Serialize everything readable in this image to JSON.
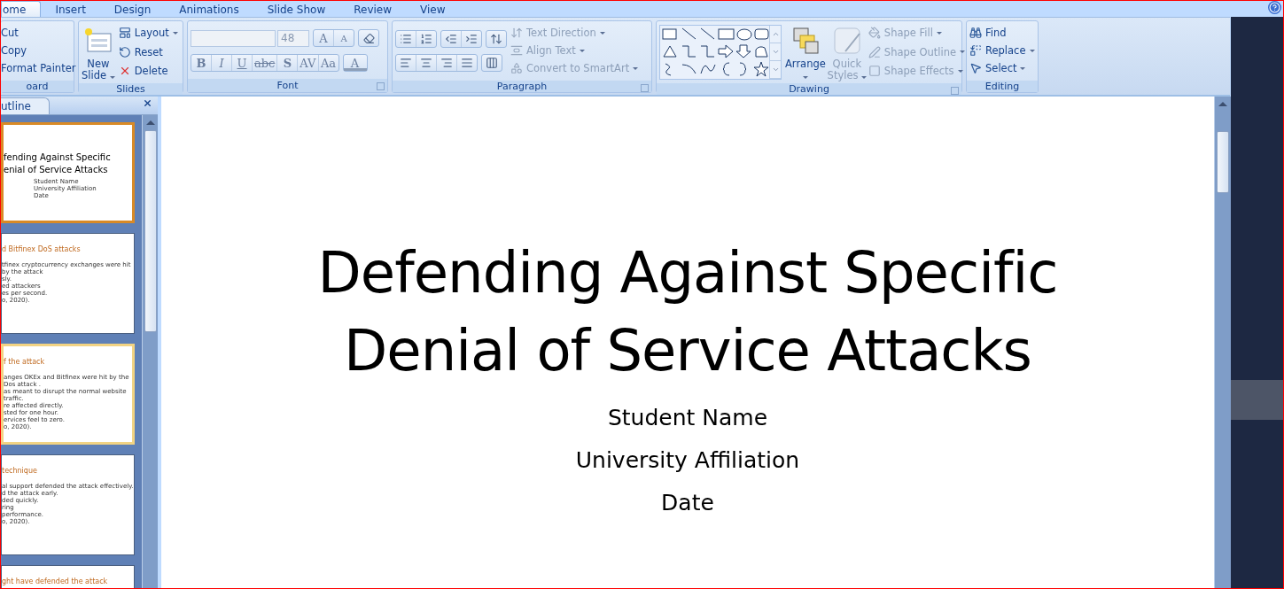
{
  "tabs": [
    {
      "label": "ome",
      "selected": true
    },
    {
      "label": "Insert",
      "selected": false
    },
    {
      "label": "Design",
      "selected": false
    },
    {
      "label": "Animations",
      "selected": false
    },
    {
      "label": "Slide Show",
      "selected": false
    },
    {
      "label": "Review",
      "selected": false
    },
    {
      "label": "View",
      "selected": false
    }
  ],
  "clipboard": {
    "title": "oard",
    "items": [
      {
        "label": "Cut"
      },
      {
        "label": "Copy"
      },
      {
        "label": "Format Painter"
      }
    ]
  },
  "slides": {
    "title": "Slides",
    "new_slide": [
      "New",
      "Slide"
    ],
    "items": [
      {
        "kind": "layout",
        "label": "Layout",
        "dropdown": true
      },
      {
        "kind": "reset",
        "label": "Reset",
        "dropdown": false
      },
      {
        "kind": "delete",
        "label": "Delete",
        "dropdown": false
      }
    ]
  },
  "font": {
    "title": "Font",
    "font_size": "48",
    "grow": "A",
    "shrink": "A",
    "styles": [
      {
        "kind": "bold",
        "label": "B"
      },
      {
        "kind": "italic",
        "label": "I"
      },
      {
        "kind": "underline",
        "label": "U"
      },
      {
        "kind": "strike",
        "label": "abc"
      },
      {
        "kind": "shadow",
        "label": "S"
      },
      {
        "kind": "spacing",
        "label": "AV"
      },
      {
        "kind": "case",
        "label": "Aa"
      }
    ],
    "color_label": "A"
  },
  "paragraph": {
    "title": "Paragraph",
    "commands": [
      {
        "kind": "direction",
        "label": "Text Direction",
        "disabled": true
      },
      {
        "kind": "align",
        "label": "Align Text",
        "disabled": true
      },
      {
        "kind": "smartart",
        "label": "Convert to SmartArt",
        "disabled": true
      }
    ]
  },
  "drawing": {
    "title": "Drawing",
    "arrange": "Arrange",
    "quick_styles": [
      "Quick",
      "Styles"
    ],
    "quick_styles_disabled": true,
    "commands": [
      {
        "kind": "fill",
        "label": "Shape Fill",
        "disabled": true
      },
      {
        "kind": "outline",
        "label": "Shape Outline",
        "disabled": true
      },
      {
        "kind": "effects",
        "label": "Shape Effects",
        "disabled": true
      }
    ]
  },
  "editing": {
    "title": "Editing",
    "commands": [
      {
        "kind": "find",
        "label": "Find",
        "dropdown": false
      },
      {
        "kind": "replace",
        "label": "Replace",
        "dropdown": true
      },
      {
        "kind": "select",
        "label": "Select",
        "dropdown": true
      }
    ]
  },
  "pane": {
    "tab": "utline",
    "slides": [
      {
        "selected": true,
        "highlighted": false,
        "kind": "title",
        "title_lines": [
          "fending Against Specific",
          "enial of Service Attacks"
        ],
        "lines": [
          "Student Name",
          "University Affiliation",
          "Date"
        ]
      },
      {
        "selected": false,
        "highlighted": false,
        "kind": "content",
        "title_lines": [
          "d Bitfinex DoS attacks"
        ],
        "lines": [
          "tfinex cryptocurrency exchanges were hit by the attack",
          "sly.",
          "ed attackers",
          "es per second.",
          "o, 2020)."
        ]
      },
      {
        "selected": false,
        "highlighted": true,
        "kind": "content",
        "title_lines": [
          "f the attack"
        ],
        "lines": [
          "anges OKEx and Bitfinex were hit by the Dos attack .",
          "as meant to disrupt the normal website traffic.",
          "re affected directly.",
          "sted for one hour.",
          "ervices feel to zero.",
          "o, 2020)."
        ]
      },
      {
        "selected": false,
        "highlighted": false,
        "kind": "content",
        "title_lines": [
          "technique"
        ],
        "lines": [
          "al support defended the attack effectively.",
          "d the attack early.",
          "ded quickly.",
          "ring",
          "performance.",
          "o, 2020)."
        ]
      },
      {
        "selected": false,
        "highlighted": false,
        "kind": "content",
        "title_lines": [
          "ght have defended the attack"
        ]
      }
    ]
  },
  "slide": {
    "title_lines": [
      "Defending Against Specific",
      "Denial of Service Attacks"
    ],
    "subtitle_lines": [
      "Student Name",
      "University Affiliation",
      "Date"
    ]
  }
}
